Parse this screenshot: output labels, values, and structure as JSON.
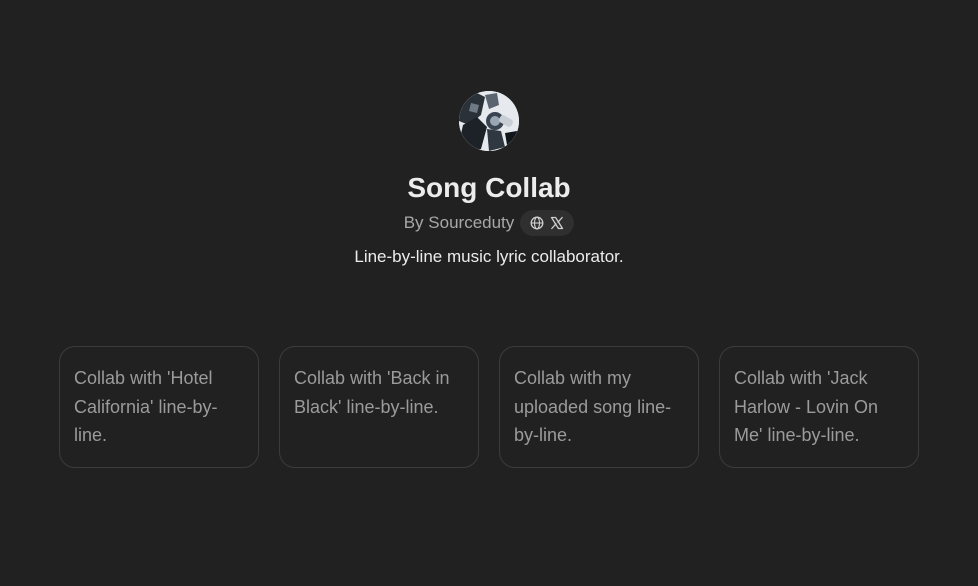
{
  "gpt": {
    "name": "Song Collab",
    "byline": "By Sourceduty",
    "description": "Line-by-line music lyric collaborator."
  },
  "social": {
    "icons": [
      "globe-icon",
      "x-logo-icon"
    ]
  },
  "starters": [
    {
      "text": "Collab with 'Hotel California' line-by-line."
    },
    {
      "text": "Collab with 'Back in Black' line-by-line."
    },
    {
      "text": "Collab with my uploaded song line-by-line."
    },
    {
      "text": "Collab with 'Jack Harlow - Lovin On Me' line-by-line."
    }
  ],
  "colors": {
    "background": "#212121",
    "title": "#ececec",
    "muted": "#a8a8a8",
    "card_border": "#3c3c3c",
    "card_text": "#9b9b9b",
    "pill": "#2f2f2f"
  }
}
